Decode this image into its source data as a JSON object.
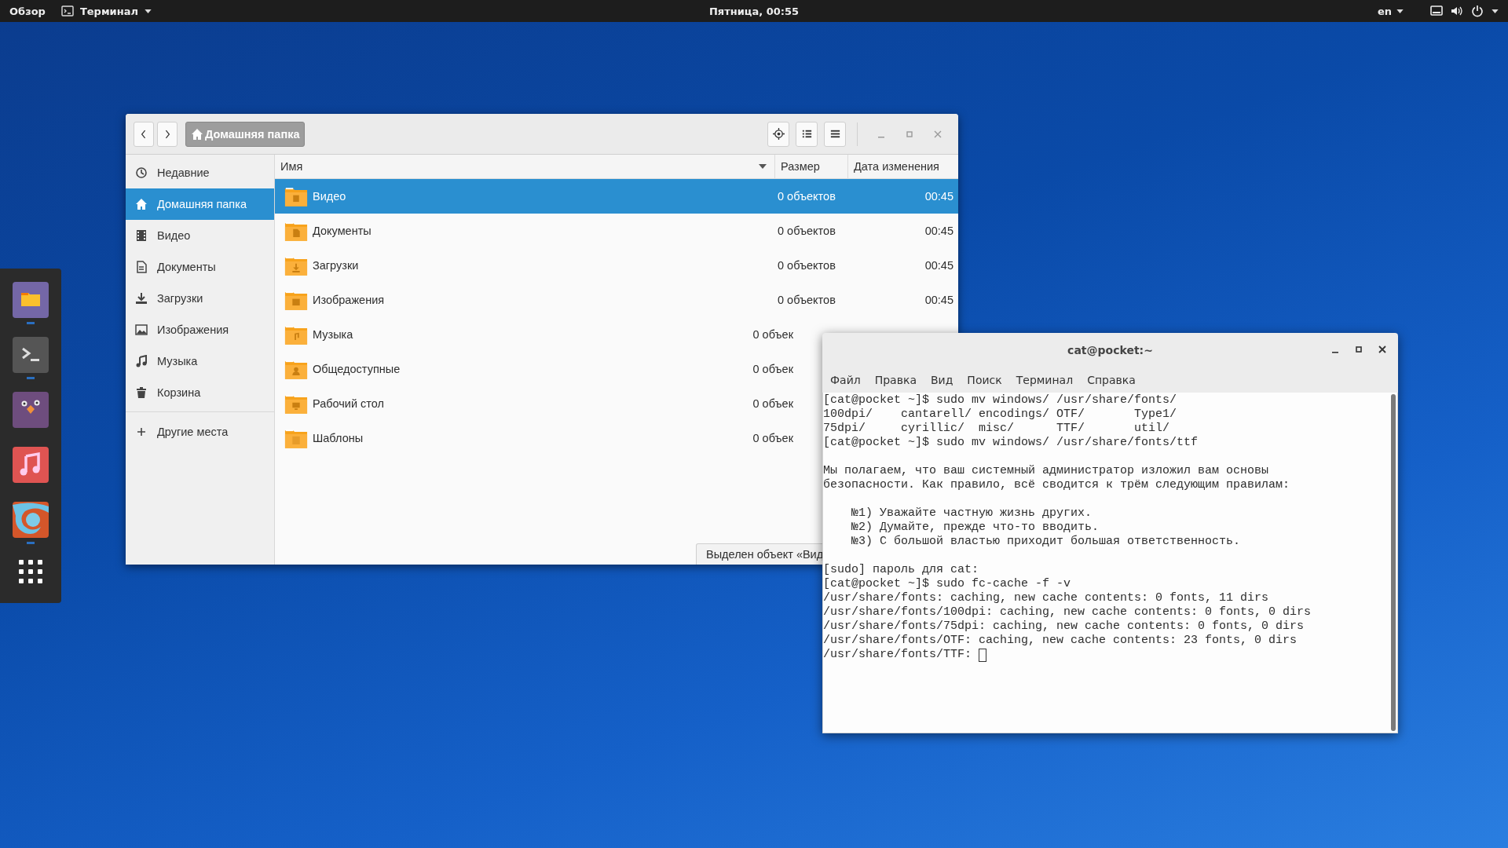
{
  "top_bar": {
    "activities": "Обзор",
    "app_menu": "Терминал",
    "clock": "Пятница, 00:55",
    "language": "en"
  },
  "dock": {
    "apps": [
      {
        "kind": "files",
        "running": true
      },
      {
        "kind": "terminal",
        "running": true
      },
      {
        "kind": "messenger",
        "running": false
      },
      {
        "kind": "music",
        "running": false
      },
      {
        "kind": "browser",
        "running": true
      }
    ]
  },
  "file_manager": {
    "path": "Домашняя папка",
    "sidebar": {
      "items": [
        {
          "label": "Недавние",
          "selected": false
        },
        {
          "label": "Домашняя папка",
          "selected": true
        },
        {
          "label": "Видео",
          "selected": false
        },
        {
          "label": "Документы",
          "selected": false
        },
        {
          "label": "Загрузки",
          "selected": false
        },
        {
          "label": "Изображения",
          "selected": false
        },
        {
          "label": "Музыка",
          "selected": false
        },
        {
          "label": "Корзина",
          "selected": false
        }
      ],
      "other_places": "Другие места"
    },
    "columns": [
      "Имя",
      "Размер",
      "Дата изменения"
    ],
    "rows": [
      {
        "name": "Видео",
        "size": "0 объектов",
        "modified": "00:45",
        "selected": true
      },
      {
        "name": "Документы",
        "size": "0 объектов",
        "modified": "00:45",
        "selected": false
      },
      {
        "name": "Загрузки",
        "size": "0 объектов",
        "modified": "00:45",
        "selected": false
      },
      {
        "name": "Изображения",
        "size": "0 объектов",
        "modified": "00:45",
        "selected": false
      },
      {
        "name": "Музыка",
        "size": "0 объек",
        "selected": false
      },
      {
        "name": "Общедоступные",
        "size": "0 объек",
        "selected": false
      },
      {
        "name": "Рабочий стол",
        "size": "0 объек",
        "selected": false
      },
      {
        "name": "Шаблоны",
        "size": "0 объек",
        "selected": false
      }
    ],
    "status": "Выделен объект «Вид"
  },
  "terminal": {
    "title": "cat@pocket:~",
    "menu": [
      "Файл",
      "Правка",
      "Вид",
      "Поиск",
      "Терминал",
      "Справка"
    ],
    "blocks": [
      [
        "[cat@pocket ~]$ sudo mv windows/ /usr/share/fonts/",
        "100dpi/    cantarell/ encodings/ OTF/       Type1/",
        "75dpi/     cyrillic/  misc/      TTF/       util/",
        "[cat@pocket ~]$ sudo mv windows/ /usr/share/fonts/ttf"
      ],
      [
        "Мы полагаем, что ваш системный администратор изложил вам основы",
        "безопасности. Как правило, всё сводится к трём следующим правилам:"
      ],
      [
        "    №1) Уважайте частную жизнь других.",
        "    №2) Думайте, прежде что-то вводить.",
        "    №3) С большой властью приходит большая ответственность."
      ],
      [
        "[sudo] пароль для cat:",
        "[cat@pocket ~]$ sudo fc-cache -f -v",
        "/usr/share/fonts: caching, new cache contents: 0 fonts, 11 dirs",
        "/usr/share/fonts/100dpi: caching, new cache contents: 0 fonts, 0 dirs",
        "/usr/share/fonts/75dpi: caching, new cache contents: 0 fonts, 0 dirs",
        "/usr/share/fonts/OTF: caching, new cache contents: 23 fonts, 0 dirs",
        "/usr/share/fonts/TTF: "
      ]
    ]
  }
}
